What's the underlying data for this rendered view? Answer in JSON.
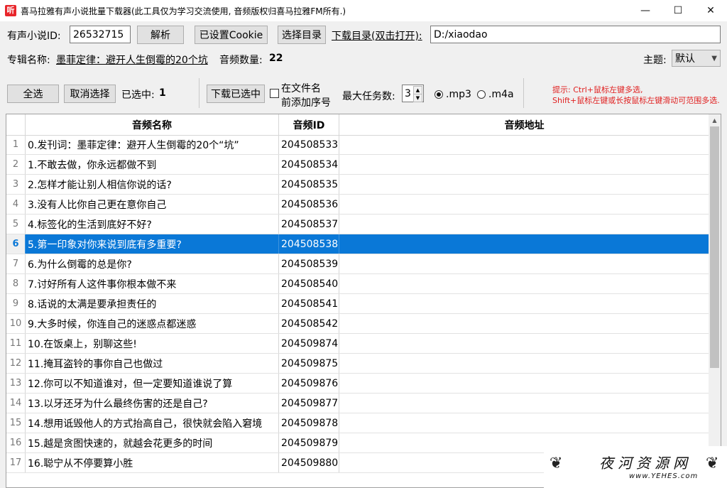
{
  "window": {
    "title": "喜马拉雅有声小说批量下载器(此工具仅为学习交流使用, 音频版权归喜马拉雅FM所有.)",
    "app_icon": "听",
    "controls": {
      "minimize": "—",
      "maximize": "☐",
      "close": "✕"
    }
  },
  "toolbar": {
    "album_id_label": "有声小说ID:",
    "album_id_value": "26532715",
    "parse_button": "解析",
    "cookie_button": "已设置Cookie",
    "select_dir_button": "选择目录",
    "download_dir_link": "下载目录(双击打开):",
    "download_dir_value": "D:/xiaodao"
  },
  "album": {
    "name_label": "专辑名称:",
    "name_value": "墨菲定律：避开人生倒霉的20个坑",
    "count_label": "音频数量:",
    "count_value": "22",
    "theme_label": "主题:",
    "theme_value": "默认"
  },
  "actions": {
    "select_all": "全选",
    "deselect": "取消选择",
    "selected_label": "已选中:",
    "selected_count": "1",
    "download_selected": "下载已选中",
    "prefix_checkbox_line1": "在文件名",
    "prefix_checkbox_line2": "前添加序号",
    "max_tasks_label": "最大任务数:",
    "max_tasks_value": "3",
    "format_mp3": ".mp3",
    "format_m4a": ".m4a",
    "hint_line1": "提示: Ctrl+鼠标左键多选,",
    "hint_line2": "Shift+鼠标左键或长按鼠标左键滑动可范围多选."
  },
  "table": {
    "headers": {
      "name": "音频名称",
      "id": "音频ID",
      "url": "音频地址"
    },
    "rows": [
      {
        "idx": "1",
        "name": "0.发刊词：墨菲定律：避开人生倒霉的20个“坑”",
        "id": "204508533",
        "url": ""
      },
      {
        "idx": "2",
        "name": "1.不敢去做，你永远都做不到",
        "id": "204508534",
        "url": ""
      },
      {
        "idx": "3",
        "name": "2.怎样才能让别人相信你说的话?",
        "id": "204508535",
        "url": ""
      },
      {
        "idx": "4",
        "name": "3.没有人比你自己更在意你自己",
        "id": "204508536",
        "url": ""
      },
      {
        "idx": "5",
        "name": "4.标签化的生活到底好不好?",
        "id": "204508537",
        "url": ""
      },
      {
        "idx": "6",
        "name": "5.第一印象对你来说到底有多重要?",
        "id": "204508538",
        "url": "",
        "selected": true
      },
      {
        "idx": "7",
        "name": "6.为什么倒霉的总是你?",
        "id": "204508539",
        "url": ""
      },
      {
        "idx": "8",
        "name": "7.讨好所有人这件事你根本做不来",
        "id": "204508540",
        "url": ""
      },
      {
        "idx": "9",
        "name": "8.话说的太满是要承担责任的",
        "id": "204508541",
        "url": ""
      },
      {
        "idx": "10",
        "name": "9.大多时候，你连自己的迷惑点都迷惑",
        "id": "204508542",
        "url": ""
      },
      {
        "idx": "11",
        "name": "10.在饭桌上，别聊这些!",
        "id": "204509874",
        "url": ""
      },
      {
        "idx": "12",
        "name": "11.掩耳盗铃的事你自己也做过",
        "id": "204509875",
        "url": ""
      },
      {
        "idx": "13",
        "name": "12.你可以不知道谁对，但一定要知道谁说了算",
        "id": "204509876",
        "url": ""
      },
      {
        "idx": "14",
        "name": "13.以牙还牙为什么最终伤害的还是自己?",
        "id": "204509877",
        "url": ""
      },
      {
        "idx": "15",
        "name": "14.想用诋毁他人的方式抬高自己，很快就会陷入窘境",
        "id": "204509878",
        "url": ""
      },
      {
        "idx": "16",
        "name": "15.越是贪图快速的，就越会花更多的时间",
        "id": "204509879",
        "url": ""
      },
      {
        "idx": "17",
        "name": "16.聪宁从不停要算小胜",
        "id": "204509880",
        "url": ""
      }
    ]
  },
  "watermark": {
    "text": "夜河资源网",
    "url": "www.YEHES.com"
  }
}
